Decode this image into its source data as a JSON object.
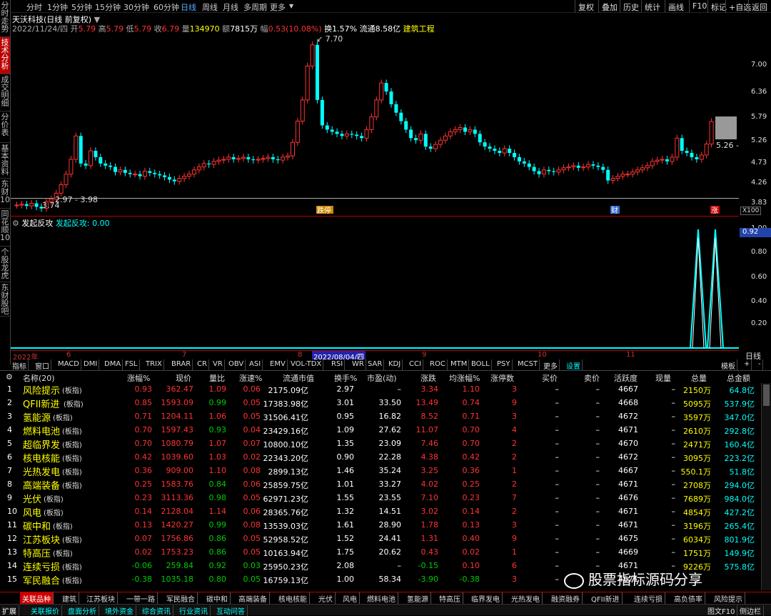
{
  "left_tabs": [
    {
      "label": "分时走势"
    },
    {
      "label": "技术分析",
      "active": true
    },
    {
      "label": "成交明细"
    },
    {
      "label": "分价表"
    },
    {
      "label": "基本资料"
    },
    {
      "label": "东财10"
    },
    {
      "label": "同花顺10"
    },
    {
      "label": "个股龙虎"
    },
    {
      "label": "东财股吧"
    }
  ],
  "periods": [
    "分时",
    "1分钟",
    "5分钟",
    "15分钟",
    "30分钟",
    "60分钟",
    "日线",
    "周线",
    "月线",
    "多周期",
    "更多"
  ],
  "active_period": "日线",
  "right_buttons": [
    "复权",
    "叠加",
    "历史",
    "统计",
    "画线",
    "F10",
    "标记",
    "+自选",
    "返回"
  ],
  "stock": {
    "title": "天沃科技(日线 前复权)",
    "date": "2022/11/24/四",
    "open_label": "开",
    "open": "5.79",
    "high_label": "高",
    "high": "5.79",
    "low_label": "低",
    "low": "5.79",
    "close_label": "收",
    "close": "6.79",
    "vol_label": "量",
    "vol": "134970",
    "amt_label": "额",
    "amt": "7815万",
    "chg_label": "幅",
    "chg": "0.53(10.08%)",
    "turnover": "换1.57%",
    "float": "流通8.58亿",
    "industry": "建筑工程"
  },
  "main_chart": {
    "y_ticks": [
      "7.00",
      "6.36",
      "5.79",
      "5.26",
      "4.73",
      "4.26",
      "3.83"
    ],
    "peak_label": "7.70",
    "low_label": "3.74",
    "range_label": "2.97 - 3.98",
    "price_tag": "5.26",
    "markers": [
      {
        "text": "跌停",
        "color": "#c80"
      },
      {
        "text": "财",
        "color": "#36c"
      },
      {
        "text": "涨",
        "color": "#c00"
      }
    ],
    "scale_label": "X100"
  },
  "indicator": {
    "name": "发起反攻",
    "value_label": "发起反攻: 0.00",
    "y_ticks": [
      "1.00",
      "0.80",
      "0.60",
      "0.40",
      "0.20"
    ],
    "value_box": "0.92"
  },
  "date_axis": {
    "labels": [
      "2022年",
      "6",
      "7",
      "8",
      "9",
      "10",
      "11"
    ],
    "cursor_date": "2022/08/04/四",
    "right_label": "日线"
  },
  "indicator_tabs": [
    "指标",
    "窗口",
    "MACD",
    "DMI",
    "DMA",
    "FSL",
    "TRIX",
    "BRAR",
    "CR",
    "VR",
    "OBV",
    "ASI",
    "EMV",
    "VOL-TDX",
    "RSI",
    "WR",
    "SAR",
    "KDJ",
    "CCI",
    "ROC",
    "MTM",
    "BOLL",
    "PSY",
    "MCST",
    "更多",
    "设置"
  ],
  "indicator_tabs_right": [
    "模板",
    "+",
    "-"
  ],
  "table": {
    "headers": [
      "名称(20)",
      "涨幅%",
      "现价",
      "量比",
      "涨速%",
      "流通市值",
      "换手%",
      "市盈(动)",
      "涨跌",
      "均涨幅%",
      "涨停数",
      "买价",
      "卖价",
      "活跃度",
      "现量",
      "总量",
      "总金额"
    ],
    "rows": [
      {
        "idx": "1",
        "name": "风险提示",
        "tag": "(板指)",
        "chg": "0.93",
        "price": "362.47",
        "vr": "1.09",
        "spd": "0.06",
        "mv": "2175.09亿",
        "to": "2.97",
        "pe": "–",
        "diff": "3.34",
        "avg": "1.10",
        "lu": "3",
        "bid": "–",
        "ask": "–",
        "act": "4667",
        "cur": "–",
        "vol": "2150万",
        "amt": "64.8亿"
      },
      {
        "idx": "2",
        "name": "QFII新进",
        "tag": "(板指)",
        "chg": "0.85",
        "price": "1593.09",
        "vr": "0.99",
        "spd": "0.05",
        "mv": "17383.98亿",
        "to": "3.01",
        "pe": "33.50",
        "diff": "13.49",
        "avg": "0.74",
        "lu": "9",
        "bid": "–",
        "ask": "–",
        "act": "4668",
        "cur": "–",
        "vol": "5095万",
        "amt": "537.9亿"
      },
      {
        "idx": "3",
        "name": "氢能源",
        "tag": "(板指)",
        "chg": "0.71",
        "price": "1204.11",
        "vr": "1.06",
        "spd": "0.05",
        "mv": "31506.41亿",
        "to": "0.95",
        "pe": "16.82",
        "diff": "8.52",
        "avg": "0.71",
        "lu": "3",
        "bid": "–",
        "ask": "–",
        "act": "4672",
        "cur": "–",
        "vol": "3597万",
        "amt": "347.0亿"
      },
      {
        "idx": "4",
        "name": "燃料电池",
        "tag": "(板指)",
        "chg": "0.70",
        "price": "1597.43",
        "vr": "0.93",
        "spd": "0.04",
        "mv": "23429.16亿",
        "to": "1.09",
        "pe": "27.62",
        "diff": "11.07",
        "avg": "0.70",
        "lu": "4",
        "bid": "–",
        "ask": "–",
        "act": "4671",
        "cur": "–",
        "vol": "2610万",
        "amt": "292.8亿"
      },
      {
        "idx": "5",
        "name": "超临界发",
        "tag": "(板指)",
        "chg": "0.70",
        "price": "1080.79",
        "vr": "1.07",
        "spd": "0.07",
        "mv": "10800.10亿",
        "to": "1.35",
        "pe": "23.09",
        "diff": "7.46",
        "avg": "0.70",
        "lu": "2",
        "bid": "–",
        "ask": "–",
        "act": "4670",
        "cur": "–",
        "vol": "2471万",
        "amt": "160.4亿"
      },
      {
        "idx": "6",
        "name": "核电核能",
        "tag": "(板指)",
        "chg": "0.42",
        "price": "1039.60",
        "vr": "1.03",
        "spd": "0.02",
        "mv": "22343.20亿",
        "to": "0.90",
        "pe": "22.28",
        "diff": "4.38",
        "avg": "0.42",
        "lu": "2",
        "bid": "–",
        "ask": "–",
        "act": "4672",
        "cur": "–",
        "vol": "3095万",
        "amt": "223.2亿"
      },
      {
        "idx": "7",
        "name": "光热发电",
        "tag": "(板指)",
        "chg": "0.36",
        "price": "909.00",
        "vr": "1.10",
        "spd": "0.08",
        "mv": "2899.13亿",
        "to": "1.46",
        "pe": "35.24",
        "diff": "3.25",
        "avg": "0.36",
        "lu": "1",
        "bid": "–",
        "ask": "–",
        "act": "4667",
        "cur": "–",
        "vol": "550.1万",
        "amt": "51.8亿"
      },
      {
        "idx": "8",
        "name": "高端装备",
        "tag": "(板指)",
        "chg": "0.25",
        "price": "1583.76",
        "vr": "0.84",
        "spd": "0.06",
        "mv": "25859.75亿",
        "to": "1.01",
        "pe": "33.27",
        "diff": "4.02",
        "avg": "0.25",
        "lu": "2",
        "bid": "–",
        "ask": "–",
        "act": "4671",
        "cur": "–",
        "vol": "2708万",
        "amt": "294.0亿"
      },
      {
        "idx": "9",
        "name": "光伏",
        "tag": "(板指)",
        "chg": "0.23",
        "price": "3113.36",
        "vr": "0.98",
        "spd": "0.05",
        "mv": "62971.23亿",
        "to": "1.55",
        "pe": "23.55",
        "diff": "7.10",
        "avg": "0.23",
        "lu": "7",
        "bid": "–",
        "ask": "–",
        "act": "4676",
        "cur": "–",
        "vol": "7689万",
        "amt": "984.0亿"
      },
      {
        "idx": "10",
        "name": "风电",
        "tag": "(板指)",
        "chg": "0.14",
        "price": "2128.04",
        "vr": "1.14",
        "spd": "0.06",
        "mv": "28365.76亿",
        "to": "1.32",
        "pe": "14.51",
        "diff": "3.02",
        "avg": "0.14",
        "lu": "2",
        "bid": "–",
        "ask": "–",
        "act": "4671",
        "cur": "–",
        "vol": "4854万",
        "amt": "427.2亿"
      },
      {
        "idx": "11",
        "name": "碳中和",
        "tag": "(板指)",
        "chg": "0.13",
        "price": "1420.27",
        "vr": "0.99",
        "spd": "0.08",
        "mv": "13539.03亿",
        "to": "1.61",
        "pe": "28.90",
        "diff": "1.78",
        "avg": "0.13",
        "lu": "3",
        "bid": "–",
        "ask": "–",
        "act": "4671",
        "cur": "–",
        "vol": "3196万",
        "amt": "265.4亿"
      },
      {
        "idx": "12",
        "name": "江苏板块",
        "tag": "(板指)",
        "chg": "0.07",
        "price": "1756.86",
        "vr": "0.86",
        "spd": "0.05",
        "mv": "52958.52亿",
        "to": "1.52",
        "pe": "24.41",
        "diff": "1.31",
        "avg": "0.40",
        "lu": "9",
        "bid": "–",
        "ask": "–",
        "act": "4675",
        "cur": "–",
        "vol": "6034万",
        "amt": "801.9亿"
      },
      {
        "idx": "13",
        "name": "特高压",
        "tag": "(板指)",
        "chg": "0.02",
        "price": "1753.23",
        "vr": "0.86",
        "spd": "0.05",
        "mv": "10163.94亿",
        "to": "1.75",
        "pe": "20.62",
        "diff": "0.43",
        "avg": "0.02",
        "lu": "1",
        "bid": "–",
        "ask": "–",
        "act": "4669",
        "cur": "–",
        "vol": "1751万",
        "amt": "149.9亿"
      },
      {
        "idx": "14",
        "name": "连续亏损",
        "tag": "(板指)",
        "chg": "-0.06",
        "price": "259.84",
        "vr": "0.92",
        "spd": "0.03",
        "mv": "25950.23亿",
        "to": "2.08",
        "pe": "–",
        "diff": "-0.15",
        "avg": "0.10",
        "lu": "6",
        "bid": "–",
        "ask": "–",
        "act": "4671",
        "cur": "–",
        "vol": "9226万",
        "amt": "575.8亿"
      },
      {
        "idx": "15",
        "name": "军民融合",
        "tag": "(板指)",
        "chg": "-0.38",
        "price": "1035.18",
        "vr": "0.80",
        "spd": "0.05",
        "mv": "16759.13亿",
        "to": "1.00",
        "pe": "58.34",
        "diff": "-3.90",
        "avg": "-0.38",
        "lu": "3",
        "bid": "–",
        "ask": "–",
        "act": "4671",
        "cur": "–",
        "vol": "",
        "amt": ""
      }
    ]
  },
  "bottom_tabs": [
    "关联品种",
    "建筑",
    "江苏板块",
    "一带一路",
    "军民融合",
    "碳中和",
    "高端装备",
    "核电核能",
    "光伏",
    "风电",
    "燃料电池",
    "氢能源",
    "特高压",
    "临界发电",
    "光热发电",
    "融资融券",
    "QFII新进",
    "连续亏损",
    "高负债率",
    "风险提示"
  ],
  "status_items": [
    "扩展",
    "关联报价",
    "盘面分析",
    "境外资金",
    "综合资讯",
    "行业资讯",
    "互动问答"
  ],
  "status_right": [
    "图文F10",
    "侧边栏"
  ],
  "watermark": "股票指标源码分享",
  "colors": {
    "up": "#ff3333",
    "down": "#00cccc",
    "accent": "#cc0000",
    "yellow": "#ffff00"
  }
}
